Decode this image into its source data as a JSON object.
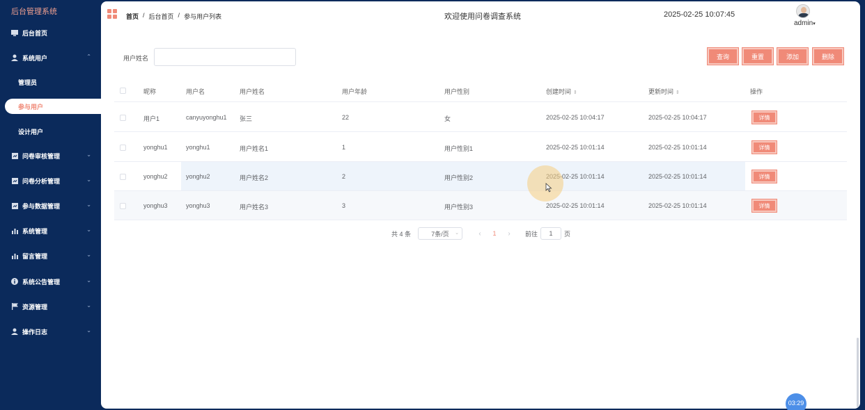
{
  "sidebar": {
    "logo": "后台管理系统",
    "items": [
      {
        "label": "后台首页",
        "icon": "monitor-icon"
      },
      {
        "label": "系统用户",
        "icon": "user-icon",
        "expanded": true
      },
      {
        "label": "问卷审核管理",
        "icon": "grid-icon"
      },
      {
        "label": "问卷分析管理",
        "icon": "grid-icon"
      },
      {
        "label": "参与数据管理",
        "icon": "grid-icon"
      },
      {
        "label": "系统管理",
        "icon": "bar-chart-icon"
      },
      {
        "label": "留言管理",
        "icon": "bar-chart-icon"
      },
      {
        "label": "系统公告管理",
        "icon": "info-icon"
      },
      {
        "label": "资源管理",
        "icon": "flag-icon"
      },
      {
        "label": "操作日志",
        "icon": "user-icon"
      }
    ],
    "submenu": [
      {
        "label": "管理员"
      },
      {
        "label": "参与用户",
        "active": true
      },
      {
        "label": "设计用户"
      }
    ]
  },
  "header": {
    "breadcrumb": [
      "首页",
      "后台首页",
      "参与用户列表"
    ],
    "breadcrumb_sep": "/",
    "welcome": "欢迎使用问卷调查系统",
    "datetime": "2025-02-25 10:07:45",
    "user": "admin"
  },
  "search": {
    "label": "用户姓名",
    "value": "",
    "placeholder": ""
  },
  "toolbar": {
    "query": "查询",
    "reset": "重置",
    "add": "添加",
    "delete": "删除"
  },
  "table": {
    "headers": [
      "昵称",
      "用户名",
      "用户姓名",
      "用户年龄",
      "用户性别",
      "创建时间",
      "更新时间",
      "操作"
    ],
    "rows": [
      {
        "nickname": "用户1",
        "username": "canyuyonghu1",
        "realname": "张三",
        "age": "22",
        "gender": "女",
        "created": "2025-02-25 10:04:17",
        "updated": "2025-02-25 10:04:17",
        "action": "详情"
      },
      {
        "nickname": "yonghu1",
        "username": "yonghu1",
        "realname": "用户姓名1",
        "age": "1",
        "gender": "用户性别1",
        "created": "2025-02-25 10:01:14",
        "updated": "2025-02-25 10:01:14",
        "action": "详情"
      },
      {
        "nickname": "yonghu2",
        "username": "yonghu2",
        "realname": "用户姓名2",
        "age": "2",
        "gender": "用户性别2",
        "created": "2025-02-25 10:01:14",
        "updated": "2025-02-25 10:01:14",
        "action": "详情"
      },
      {
        "nickname": "yonghu3",
        "username": "yonghu3",
        "realname": "用户姓名3",
        "age": "3",
        "gender": "用户性别3",
        "created": "2025-02-25 10:01:14",
        "updated": "2025-02-25 10:01:14",
        "action": "详情"
      }
    ]
  },
  "pagination": {
    "total": "共 4 条",
    "page_size": "7条/页",
    "current": "1",
    "goto_prefix": "前往",
    "goto_value": "1",
    "goto_suffix": "页"
  },
  "timer": "03:29",
  "colors": {
    "sidebar": "#0b2a5b",
    "accent": "#f08a78",
    "hover_row": "#eef4fb"
  }
}
